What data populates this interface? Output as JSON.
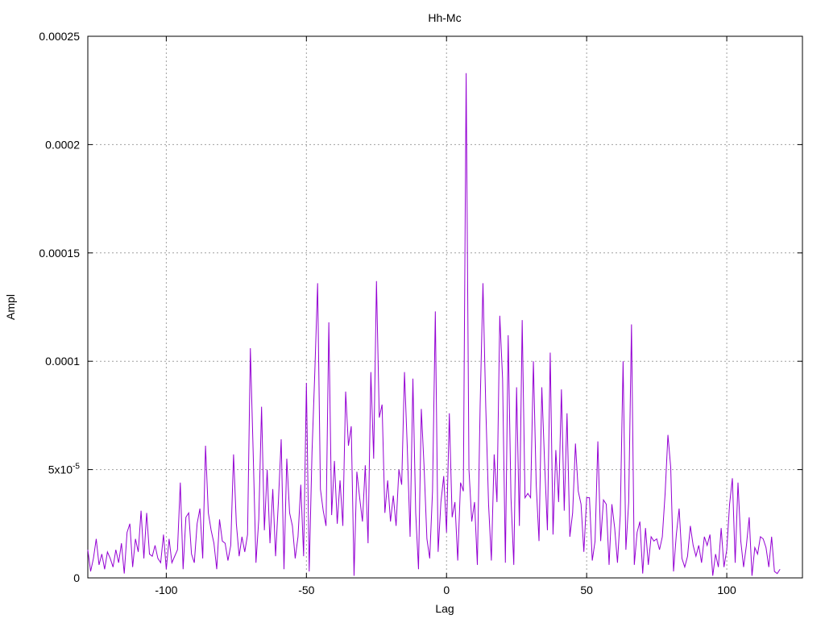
{
  "chart_data": {
    "type": "line",
    "title": "Hh-Mc",
    "xlabel": "Lag",
    "ylabel": "Ampl",
    "xlim": [
      -128,
      127
    ],
    "ylim": [
      0,
      0.00025
    ],
    "grid": true,
    "legend": "none",
    "line_color": "#9400d3",
    "x_ticks": [
      -100,
      -50,
      0,
      50,
      100
    ],
    "x_tick_labels": [
      "-100",
      "-50",
      "0",
      "50",
      "100"
    ],
    "y_ticks": [
      0,
      5e-05,
      0.0001,
      0.00015,
      0.0002,
      0.00025
    ],
    "y_tick_labels": [
      {
        "base": "0",
        "sup": ""
      },
      {
        "base": "5x10",
        "sup": "-5"
      },
      {
        "base": "0.0001",
        "sup": ""
      },
      {
        "base": "0.00015",
        "sup": ""
      },
      {
        "base": "0.0002",
        "sup": ""
      },
      {
        "base": "0.00025",
        "sup": ""
      }
    ],
    "series": [
      {
        "x_start": -128,
        "x_step": 1,
        "values": [
          1.3e-05,
          3e-06,
          9e-06,
          1.8e-05,
          6e-06,
          1.1e-05,
          4e-06,
          1.2e-05,
          9e-06,
          5e-06,
          1.3e-05,
          7e-06,
          1.6e-05,
          2e-06,
          2.1e-05,
          2.5e-05,
          5e-06,
          1.8e-05,
          1.2e-05,
          3.1e-05,
          9e-06,
          3e-05,
          1.1e-05,
          1e-05,
          1.5e-05,
          9e-06,
          7e-06,
          2e-05,
          4e-06,
          1.8e-05,
          7e-06,
          1e-05,
          1.3e-05,
          4.4e-05,
          4e-06,
          2.8e-05,
          3e-05,
          1.1e-05,
          7e-06,
          2.5e-05,
          3.2e-05,
          9e-06,
          6.1e-05,
          3e-05,
          2.2e-05,
          1.6e-05,
          4e-06,
          2.7e-05,
          1.7e-05,
          1.6e-05,
          8e-06,
          1.5e-05,
          5.7e-05,
          2.5e-05,
          1e-05,
          1.9e-05,
          1.2e-05,
          2e-05,
          0.000106,
          5.8e-05,
          7e-06,
          2.7e-05,
          7.9e-05,
          2.2e-05,
          5e-05,
          1.6e-05,
          4.1e-05,
          1e-05,
          3.5e-05,
          6.4e-05,
          4e-06,
          5.5e-05,
          3e-05,
          2.4e-05,
          9e-06,
          1.9e-05,
          4.3e-05,
          1e-05,
          9e-05,
          3e-06,
          5.8e-05,
          9.5e-05,
          0.000136,
          4.1e-05,
          3.1e-05,
          2.4e-05,
          0.000118,
          2.9e-05,
          5.4e-05,
          2.5e-05,
          4.5e-05,
          2.4e-05,
          8.6e-05,
          6.1e-05,
          7e-05,
          1e-06,
          4.9e-05,
          3.7e-05,
          2.6e-05,
          5.2e-05,
          1.6e-05,
          9.5e-05,
          5.5e-05,
          0.000137,
          7.4e-05,
          8e-05,
          3e-05,
          4.5e-05,
          2.6e-05,
          3.8e-05,
          2.4e-05,
          5e-05,
          4.3e-05,
          9.5e-05,
          6e-05,
          1.9e-05,
          9.2e-05,
          3e-05,
          4e-06,
          7.8e-05,
          5.1e-05,
          1.8e-05,
          9e-06,
          4e-05,
          0.000123,
          1.2e-05,
          3.5e-05,
          4.7e-05,
          2.1e-05,
          7.6e-05,
          2.8e-05,
          3.5e-05,
          8e-06,
          4.4e-05,
          4e-05,
          0.000233,
          5e-05,
          2.6e-05,
          3.5e-05,
          6e-06,
          8e-05,
          0.000136,
          7.9e-05,
          3.4e-05,
          8e-06,
          5.7e-05,
          3.5e-05,
          0.000121,
          9.2e-05,
          7e-06,
          0.000112,
          3.7e-05,
          6e-06,
          8.8e-05,
          2.4e-05,
          0.000119,
          3.7e-05,
          3.9e-05,
          3.7e-05,
          0.0001,
          4.3e-05,
          1.7e-05,
          8.8e-05,
          5.3e-05,
          2.2e-05,
          0.000104,
          2e-05,
          5.9e-05,
          3.5e-05,
          8.7e-05,
          3.1e-05,
          7.6e-05,
          1.9e-05,
          3e-05,
          6.2e-05,
          4e-05,
          3.4e-05,
          1.2e-05,
          3.7e-05,
          3.7e-05,
          8e-06,
          1.7e-05,
          6.3e-05,
          1.7e-05,
          3.6e-05,
          3.4e-05,
          6e-06,
          3.4e-05,
          2.3e-05,
          7e-06,
          2.9e-05,
          0.0001,
          1.3e-05,
          3.5e-05,
          0.000117,
          6e-06,
          2.1e-05,
          2.6e-05,
          2e-06,
          2.3e-05,
          6e-06,
          1.9e-05,
          1.7e-05,
          1.8e-05,
          1.3e-05,
          1.9e-05,
          3.9e-05,
          6.6e-05,
          5.1e-05,
          3e-06,
          2e-05,
          3.2e-05,
          9e-06,
          5e-06,
          1e-05,
          2.4e-05,
          1.5e-05,
          1e-05,
          1.5e-05,
          7e-06,
          1.9e-05,
          1.5e-05,
          2e-05,
          1e-06,
          1.1e-05,
          5e-06,
          2.3e-05,
          5e-06,
          1.3e-05,
          3.4e-05,
          4.6e-05,
          7e-06,
          4.4e-05,
          1.7e-05,
          5e-06,
          1.5e-05,
          2.8e-05,
          1e-06,
          1.4e-05,
          1.1e-05,
          1.9e-05,
          1.8e-05,
          1.4e-05,
          5e-06,
          1.9e-05,
          3e-06,
          2e-06,
          4e-06
        ]
      }
    ]
  }
}
